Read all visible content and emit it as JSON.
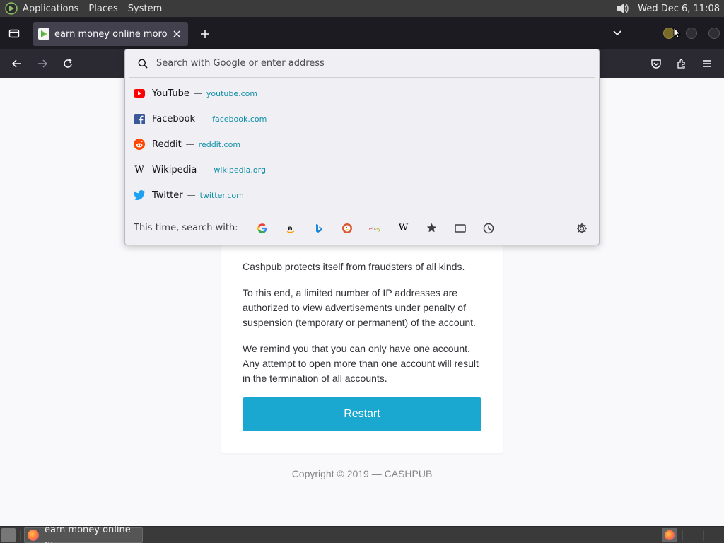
{
  "top_panel": {
    "menus": [
      "Applications",
      "Places",
      "System"
    ],
    "clock": "Wed Dec  6, 11:08",
    "icons": [
      "gnome-logo-icon",
      "volume-icon"
    ]
  },
  "tab": {
    "title": "earn money online morocco"
  },
  "urlbar": {
    "placeholder": "Search with Google or enter address",
    "results": [
      {
        "name": "YouTube",
        "sep": "—",
        "url": "youtube.com",
        "icon": "youtube-icon",
        "color": "#ff0000"
      },
      {
        "name": "Facebook",
        "sep": "—",
        "url": "facebook.com",
        "icon": "facebook-icon",
        "color": "#3b5998"
      },
      {
        "name": "Reddit",
        "sep": "—",
        "url": "reddit.com",
        "icon": "reddit-icon",
        "color": "#ff4500"
      },
      {
        "name": "Wikipedia",
        "sep": "—",
        "url": "wikipedia.org",
        "icon": "wikipedia-icon",
        "color": "#000000"
      },
      {
        "name": "Twitter",
        "sep": "—",
        "url": "twitter.com",
        "icon": "twitter-icon",
        "color": "#1da1f2"
      }
    ],
    "oneoff_label": "This time, search with:",
    "engines": [
      "google-icon",
      "amazon-icon",
      "bing-icon",
      "duckduckgo-icon",
      "ebay-icon",
      "wikipedia-icon",
      "bookmarks-icon",
      "tabs-icon",
      "history-icon"
    ]
  },
  "page": {
    "para1": "Cashpub protects itself from fraudsters of all kinds.",
    "para2": "To this end, a limited number of IP addresses are authorized to view advertisements under penalty of suspension (temporary or permanent) of the account.",
    "para3": "We remind you that you can only have one account. Any attempt to open more than one account will result in the termination of all accounts.",
    "restart_label": "Restart",
    "copyright": "Copyright © 2019 — CASHPUB",
    "accent": "#1aa8d0"
  },
  "taskbar": {
    "task_label": "earn money online ..."
  }
}
